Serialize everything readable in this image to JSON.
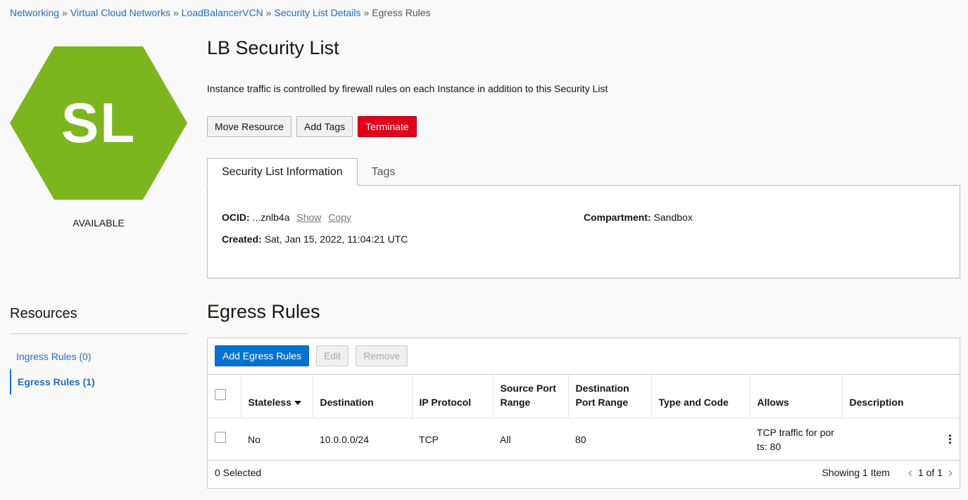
{
  "breadcrumb": [
    {
      "label": "Networking"
    },
    {
      "label": "Virtual Cloud Networks"
    },
    {
      "label": "LoadBalancerVCN"
    },
    {
      "label": "Security List Details"
    },
    {
      "label": "Egress Rules"
    }
  ],
  "breadcrumb_sep": "»",
  "resource_icon": {
    "initials": "SL",
    "color": "#7cb51e",
    "status": "AVAILABLE"
  },
  "page": {
    "title": "LB Security List",
    "description": "Instance traffic is controlled by firewall rules on each Instance in addition to this Security List"
  },
  "actions": {
    "move": "Move Resource",
    "tags": "Add Tags",
    "terminate": "Terminate"
  },
  "tabs": [
    "Security List Information",
    "Tags"
  ],
  "info": {
    "ocid_label": "OCID:",
    "ocid_value": "...znlb4a",
    "show": "Show",
    "copy": "Copy",
    "created_label": "Created:",
    "created_value": "Sat, Jan 15, 2022, 11:04:21 UTC",
    "compartment_label": "Compartment:",
    "compartment_value": "Sandbox"
  },
  "resources": {
    "heading": "Resources",
    "items": [
      {
        "label": "Ingress Rules (0)"
      },
      {
        "label": "Egress Rules (1)"
      }
    ]
  },
  "section": {
    "title": "Egress Rules"
  },
  "toolbar": {
    "add": "Add Egress Rules",
    "edit": "Edit",
    "remove": "Remove"
  },
  "table": {
    "headers": [
      "Stateless",
      "Destination",
      "IP Protocol",
      "Source Port Range",
      "Destination Port Range",
      "Type and Code",
      "Allows",
      "Description"
    ],
    "rows": [
      {
        "stateless": "No",
        "destination": "10.0.0.0/24",
        "protocol": "TCP",
        "src_port": "All",
        "dst_port": "80",
        "type_code": "",
        "allows": "TCP traffic for ports: 80",
        "description": ""
      }
    ]
  },
  "footer": {
    "selected": "0 Selected",
    "showing": "Showing 1 Item",
    "page": "1 of 1"
  },
  "colors": {
    "primary": "#0572ce",
    "danger": "#e0001b",
    "link": "#1d6fbf"
  }
}
